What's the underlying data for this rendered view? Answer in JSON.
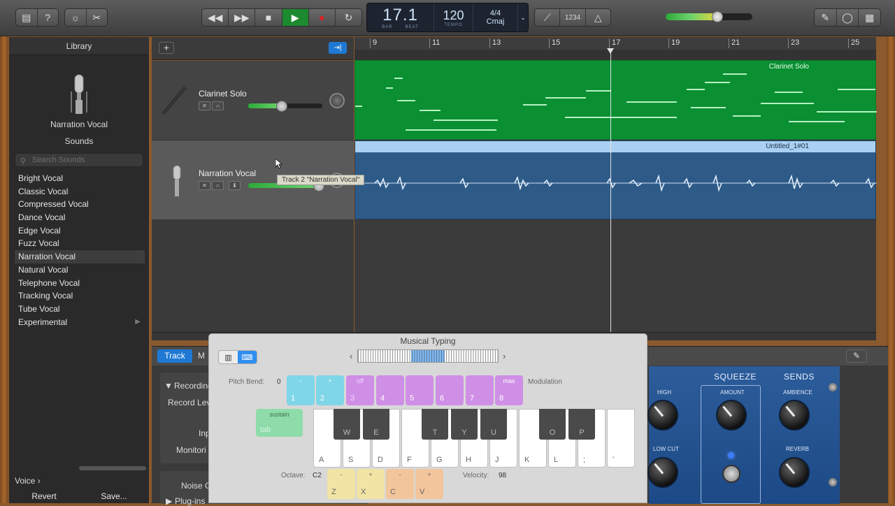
{
  "toolbar": {
    "library_icon": "library-icon",
    "help_icon": "help-icon",
    "smart_controls_icon": "smart-controls-icon",
    "editors_icon": "scissors-icon",
    "lcd": {
      "position": "17.1",
      "bar_label": "BAR",
      "beat_label": "BEAT",
      "tempo": "120",
      "tempo_label": "TEMPO",
      "time_sig": "4/4",
      "key": "Cmaj"
    },
    "count_in_label": "1234",
    "master_volume": 0.6
  },
  "library": {
    "title": "Library",
    "patch_name": "Narration Vocal",
    "sounds_label": "Sounds",
    "search_placeholder": "Search Sounds",
    "items": [
      {
        "label": "Bright Vocal"
      },
      {
        "label": "Classic Vocal"
      },
      {
        "label": "Compressed Vocal"
      },
      {
        "label": "Dance Vocal"
      },
      {
        "label": "Edge Vocal"
      },
      {
        "label": "Fuzz Vocal"
      },
      {
        "label": "Narration Vocal",
        "selected": true
      },
      {
        "label": "Natural Vocal"
      },
      {
        "label": "Telephone Vocal"
      },
      {
        "label": "Tracking Vocal"
      },
      {
        "label": "Tube Vocal"
      },
      {
        "label": "Experimental",
        "has_submenu": true
      }
    ],
    "category": "Voice",
    "category_arrow": "›",
    "revert_label": "Revert",
    "save_label": "Save..."
  },
  "tracks": [
    {
      "name": "Clarinet Solo",
      "volume": 0.45
    },
    {
      "name": "Narration Vocal",
      "volume": 0.95
    }
  ],
  "tooltip": "Track 2 \"Narration Vocal\"",
  "ruler": {
    "bars": [
      "9",
      "11",
      "13",
      "15",
      "17",
      "19",
      "21",
      "23",
      "25"
    ]
  },
  "regions": {
    "green_name": "Clarinet Solo",
    "blue_name": "Untitled_1#01"
  },
  "smart_controls": {
    "tab_track": "Track",
    "tab_m": "M",
    "recording": "Recording",
    "record_level": "Record Lev",
    "input": "Inp",
    "monitoring": "Monitori",
    "noise_gate": "Noise G",
    "plugins": "Plug-ins",
    "plugin": {
      "squeeze": "SQUEEZE",
      "sends": "SENDS",
      "high": "HIGH",
      "low_cut": "LOW CUT",
      "amount": "AMOUNT",
      "ambience": "AMBIENCE",
      "reverb": "REVERB"
    }
  },
  "musical_typing": {
    "title": "Musical Typing",
    "pitch_bend_label": "Pitch Bend:",
    "pitch_bend_value": "0",
    "modulation_label": "Modulation",
    "octave_label": "Octave:",
    "octave_value": "C2",
    "velocity_label": "Velocity:",
    "velocity_value": "98",
    "number_keys": [
      {
        "num": "1",
        "top": "-"
      },
      {
        "num": "2",
        "top": "+"
      },
      {
        "num": "3",
        "top": "off"
      },
      {
        "num": "4",
        "top": ""
      },
      {
        "num": "5",
        "top": ""
      },
      {
        "num": "6",
        "top": ""
      },
      {
        "num": "7",
        "top": ""
      },
      {
        "num": "8",
        "top": "max"
      }
    ],
    "tab_key": {
      "top": "sustain",
      "bot": "tab"
    },
    "white_keys": [
      "A",
      "S",
      "D",
      "F",
      "G",
      "H",
      "J",
      "K",
      "L",
      ";",
      "'"
    ],
    "black_keys": [
      "W",
      "E",
      "T",
      "Y",
      "U",
      "O",
      "P"
    ],
    "bottom_keys": [
      {
        "key": "Z",
        "top": "-"
      },
      {
        "key": "X",
        "top": "+"
      },
      {
        "key": "C",
        "top": "-"
      },
      {
        "key": "V",
        "top": "+"
      }
    ]
  }
}
